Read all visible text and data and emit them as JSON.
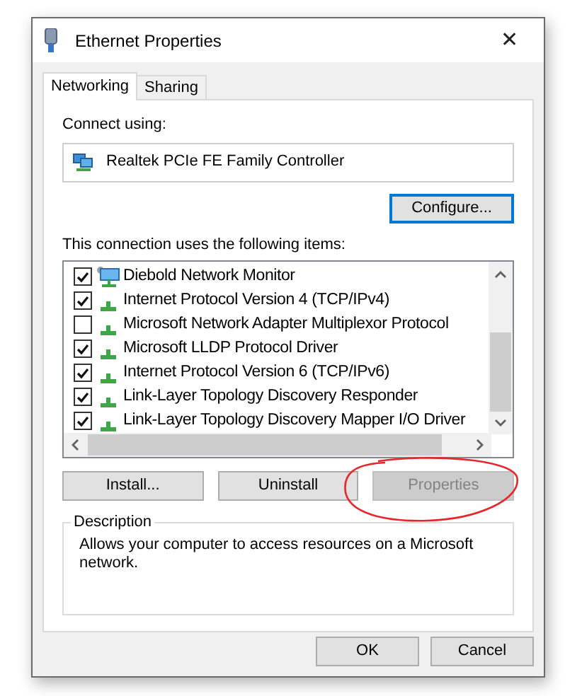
{
  "window": {
    "title": "Ethernet Properties",
    "close": "✕"
  },
  "tabs": [
    {
      "label": "Networking",
      "selected": true
    },
    {
      "label": "Sharing",
      "selected": false
    }
  ],
  "connect_using": {
    "label": "Connect using:",
    "adapter": "Realtek PCIe FE Family Controller"
  },
  "configure_button": {
    "label": "Configure...",
    "focused": true
  },
  "items_label": "This connection uses the following items:",
  "items": [
    {
      "label": "Diebold Network Monitor",
      "checked": true,
      "kind": "monitor"
    },
    {
      "label": "Internet Protocol Version 4 (TCP/IPv4)",
      "checked": true,
      "kind": "protocol"
    },
    {
      "label": "Microsoft Network Adapter Multiplexor Protocol",
      "checked": false,
      "kind": "protocol"
    },
    {
      "label": "Microsoft LLDP Protocol Driver",
      "checked": true,
      "kind": "protocol"
    },
    {
      "label": "Internet Protocol Version 6 (TCP/IPv6)",
      "checked": true,
      "kind": "protocol"
    },
    {
      "label": "Link-Layer Topology Discovery Responder",
      "checked": true,
      "kind": "protocol"
    },
    {
      "label": "Link-Layer Topology Discovery Mapper I/O Driver",
      "checked": true,
      "kind": "protocol"
    }
  ],
  "item_buttons": [
    {
      "label": "Install...",
      "disabled": false,
      "circled": false
    },
    {
      "label": "Uninstall",
      "disabled": false,
      "circled": false
    },
    {
      "label": "Properties",
      "disabled": true,
      "circled": true
    }
  ],
  "description": {
    "title": "Description",
    "text": "Allows your computer to access resources on a Microsoft network."
  },
  "dialog_buttons": [
    {
      "label": "OK"
    },
    {
      "label": "Cancel"
    }
  ]
}
